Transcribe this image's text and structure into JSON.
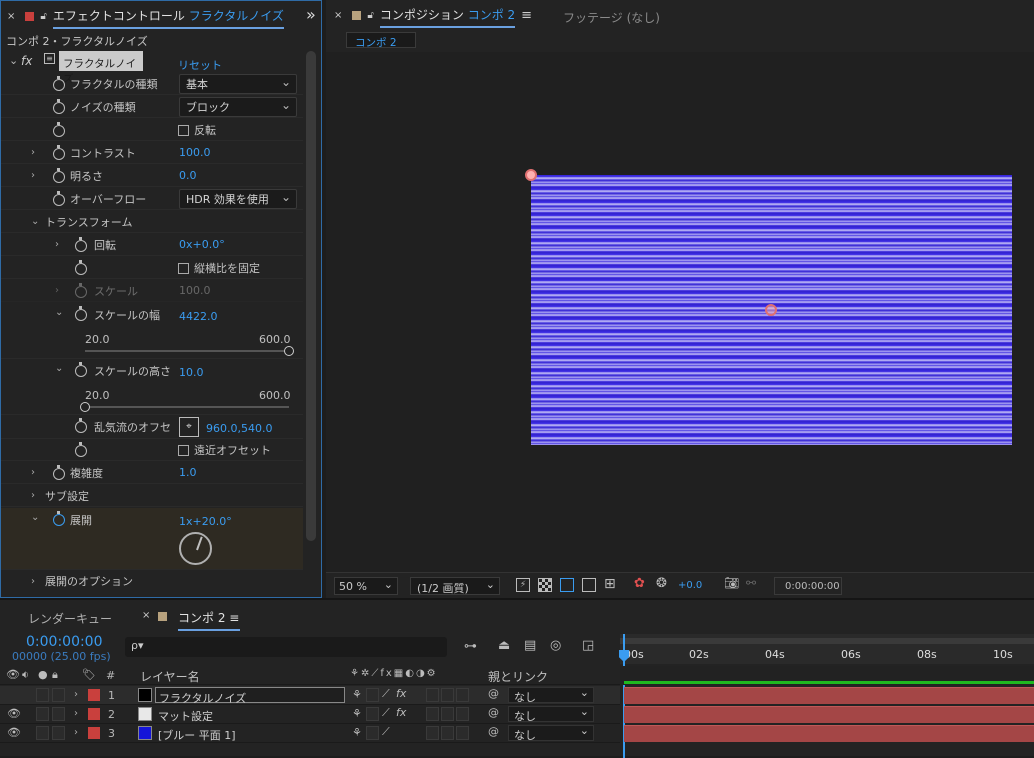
{
  "effect_panel": {
    "close_glyph": "×",
    "tab_prefix": "エフェクトコントロール",
    "tab_target": "フラクタルノイズ",
    "overflow_glyph": "»",
    "breadcrumb": "コンポ 2・フラクタルノイズ",
    "effect_name": "フラクタルノイズ",
    "reset": "リセット",
    "fx_glyph": "fx",
    "rows": {
      "fractal_type": {
        "label": "フラクタルの種類",
        "value": "基本"
      },
      "noise_type": {
        "label": "ノイズの種類",
        "value": "ブロック"
      },
      "invert": {
        "label": "反転"
      },
      "contrast": {
        "label": "コントラスト",
        "value": "100.0"
      },
      "brightness": {
        "label": "明るさ",
        "value": "0.0"
      },
      "overflow": {
        "label": "オーバーフロー",
        "value": "HDR 効果を使用"
      },
      "transform": {
        "label": "トランスフォーム"
      },
      "rotation": {
        "label": "回転",
        "value": "0x+0.0°"
      },
      "uniform_scale": {
        "label": "縦横比を固定"
      },
      "scale": {
        "label": "スケール",
        "value": "100.0"
      },
      "scale_width": {
        "label": "スケールの幅",
        "value": "4422.0",
        "min": "20.0",
        "max": "600.0"
      },
      "scale_height": {
        "label": "スケールの高さ",
        "value": "10.0",
        "min": "20.0",
        "max": "600.0"
      },
      "offset": {
        "label": "乱気流のオフセ",
        "value": "960.0,540.0"
      },
      "perspective": {
        "label": "遠近オフセット"
      },
      "complexity": {
        "label": "複雑度",
        "value": "1.0"
      },
      "sub": {
        "label": "サブ設定"
      },
      "evolution": {
        "label": "展開",
        "value": "1x+20.0°"
      },
      "evo_options": {
        "label": "展開のオプション"
      }
    },
    "slider_levels": {
      "scale_width": 1.0,
      "scale_height": 0.0
    }
  },
  "comp_panel": {
    "close_glyph": "×",
    "tab_prefix": "コンポジション",
    "tab_name": "コンポ 2",
    "menu_glyph": "≡",
    "footage_tab": "フッテージ (なし)",
    "sub_tab": "コンポ 2",
    "zoom": "50 %",
    "resolution": "(1/2 画質)",
    "exposure": "+0.0",
    "timecode": "0:00:00:00"
  },
  "timeline": {
    "render_queue": "レンダーキュー",
    "close_glyph": "×",
    "comp_tab": "コンポ 2",
    "menu_glyph": "≡",
    "timecode": "0:00:00:00",
    "frames": "00000 (25.00 fps)",
    "search_glyph": "ρ▾",
    "col_hash": "#",
    "col_layer": "レイヤー名",
    "col_parent": "親とリンク",
    "time_marks": [
      "00s",
      "02s",
      "04s",
      "06s",
      "08s",
      "10s"
    ],
    "layers": [
      {
        "num": "1",
        "name": "フラクタルノイズ",
        "parent": "なし",
        "label_color": "#c9403d",
        "thumb": "#000000"
      },
      {
        "num": "2",
        "name": "マット設定",
        "parent": "なし",
        "label_color": "#c9403d",
        "thumb": "#e8e8e8"
      },
      {
        "num": "3",
        "name": "[ブルー 平面 1]",
        "parent": "なし",
        "label_color": "#c9403d",
        "thumb": "#1414d8"
      }
    ]
  },
  "colors": {
    "accent": "#3a9cf0",
    "label_red": "#c9403d",
    "bar_red": "#a44646",
    "panel_border": "#2f6ba6"
  }
}
